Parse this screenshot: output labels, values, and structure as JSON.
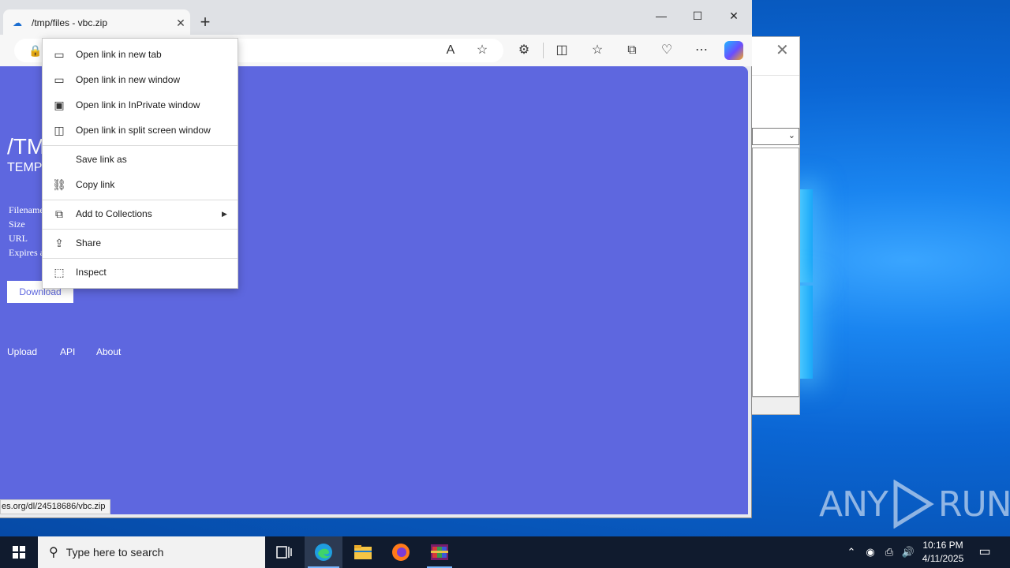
{
  "browser": {
    "tab_title": "/tmp/files - vbc.zip",
    "new_tab_symbol": "+",
    "status_url": "es.org/dl/24518686/vbc.zip"
  },
  "page": {
    "title": "/TMP",
    "subtitle": "TEMP",
    "labels": [
      "Filename",
      "Size",
      "URL",
      "Expires a"
    ],
    "download_label": "Download",
    "footer_links": [
      "Upload",
      "API",
      "About"
    ],
    "background_color": "#5e67df"
  },
  "context_menu": {
    "items": [
      {
        "label": "Open link in new tab",
        "icon": "new-tab-icon"
      },
      {
        "label": "Open link in new window",
        "icon": "new-window-icon"
      },
      {
        "label": "Open link in InPrivate window",
        "icon": "inprivate-icon"
      },
      {
        "label": "Open link in split screen window",
        "icon": "split-screen-icon"
      },
      {
        "label": "Save link as",
        "icon": ""
      },
      {
        "label": "Copy link",
        "icon": "link-icon"
      },
      {
        "label": "Add to Collections",
        "icon": "collections-icon"
      },
      {
        "label": "Share",
        "icon": "share-icon"
      },
      {
        "label": "Inspect",
        "icon": "inspect-icon"
      }
    ]
  },
  "taskbar": {
    "search_placeholder": "Type here to search",
    "time": "10:16 PM",
    "date": "4/11/2025"
  },
  "watermark": "ANY RUN"
}
